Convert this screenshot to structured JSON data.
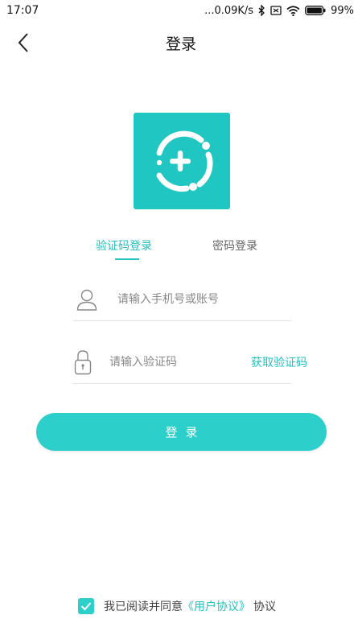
{
  "status_bar": {
    "time": "17:07",
    "network_speed": "...0.09K/s",
    "battery": "99%",
    "icons": [
      "bluetooth-icon",
      "sim-icon",
      "wifi-icon",
      "battery-icon"
    ]
  },
  "header": {
    "title": "登录",
    "back_icon": "chevron-left-icon"
  },
  "logo": {
    "icon": "plus-circle-logo",
    "color": "#20c6c2"
  },
  "tabs": [
    {
      "label": "验证码登录",
      "active": true
    },
    {
      "label": "密码登录",
      "active": false
    }
  ],
  "form": {
    "account": {
      "placeholder": "请输入手机号或账号",
      "value": "",
      "icon": "user-icon"
    },
    "code": {
      "placeholder": "请输入验证码",
      "value": "",
      "icon": "lock-icon",
      "get_code_label": "获取验证码"
    }
  },
  "login_button": {
    "label": "登录"
  },
  "agreement": {
    "checked": true,
    "prefix": "我已阅读并同意",
    "link": "《用户协议》",
    "suffix": "协议"
  },
  "colors": {
    "accent": "#23c2bf",
    "button": "#2dcfcb",
    "divider": "#e3e3e3"
  }
}
